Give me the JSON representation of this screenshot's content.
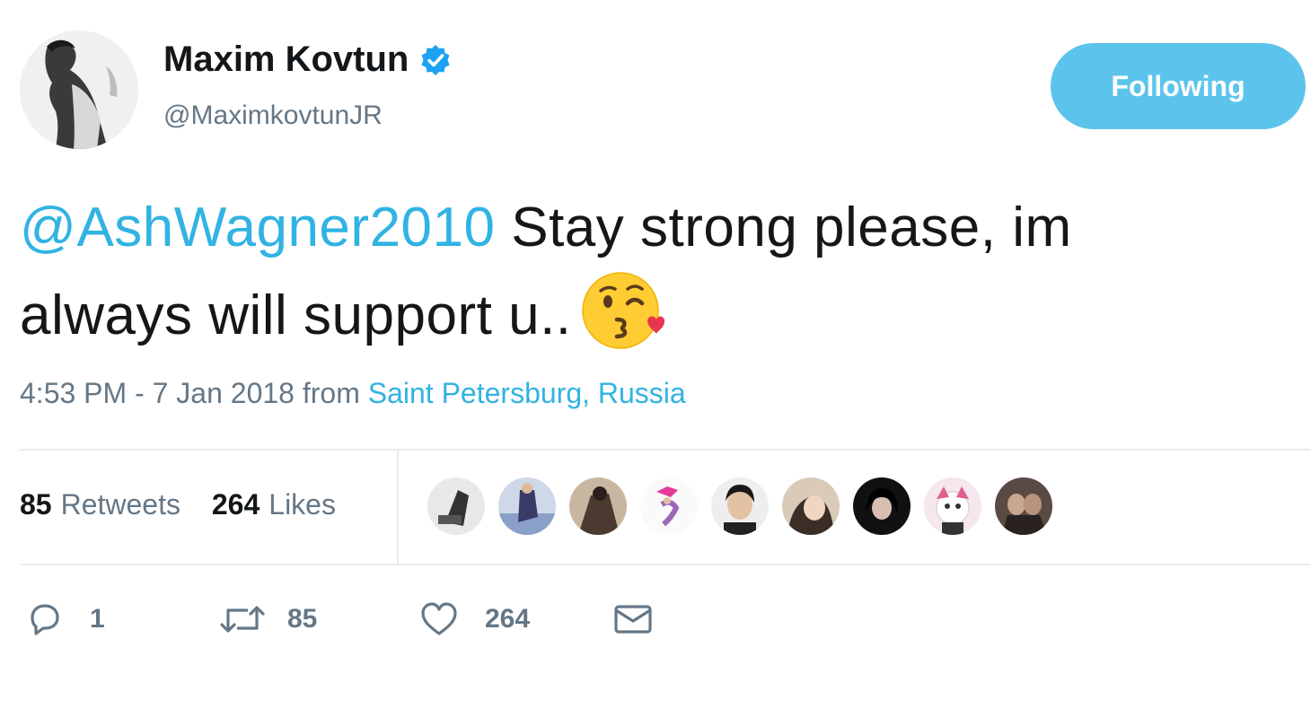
{
  "author": {
    "name": "Maxim Kovtun",
    "handle": "@MaximkovtunJR",
    "verified": true
  },
  "follow_button": {
    "label": "Following"
  },
  "tweet": {
    "mention": "@AshWagner2010",
    "text_line1_rest": " Stay strong please, im",
    "text_line2": "always will support u..",
    "emoji": "face-throwing-a-kiss-emoji"
  },
  "meta": {
    "timestamp": "4:53 PM - 7 Jan 2018",
    "from": "from",
    "place": "Saint Petersburg, Russia"
  },
  "stats": {
    "retweets_count": "85",
    "retweets_label": "Retweets",
    "likes_count": "264",
    "likes_label": "Likes"
  },
  "likers": [
    {
      "icon": "liker-avatar-1"
    },
    {
      "icon": "liker-avatar-2"
    },
    {
      "icon": "liker-avatar-3"
    },
    {
      "icon": "liker-avatar-4"
    },
    {
      "icon": "liker-avatar-5"
    },
    {
      "icon": "liker-avatar-6"
    },
    {
      "icon": "liker-avatar-7"
    },
    {
      "icon": "liker-avatar-8"
    },
    {
      "icon": "liker-avatar-9"
    }
  ],
  "actions": {
    "reply_count": "1",
    "retweet_count": "85",
    "like_count": "264",
    "message_icon": "envelope-icon"
  },
  "colors": {
    "accent": "#31b3e3",
    "follow_button_bg": "#5cc4ec",
    "secondary_text": "#657786",
    "primary_text": "#14171a",
    "divider": "#e6ecf0"
  }
}
